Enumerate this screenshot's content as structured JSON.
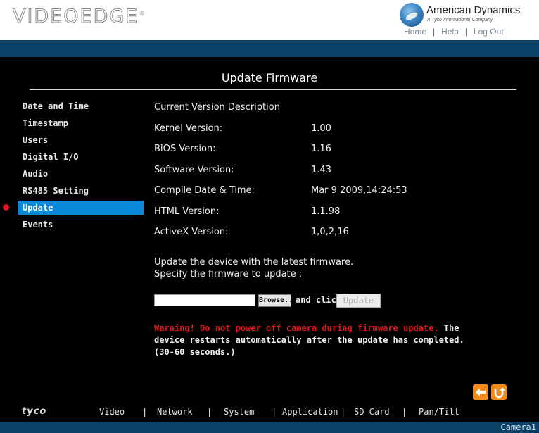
{
  "brand": {
    "logo": "VIDEOEDGE",
    "logo_reg": "®",
    "company": "American Dynamics",
    "company_sub": "A Tyco International Company"
  },
  "topnav": {
    "home": "Home",
    "help": "Help",
    "logout": "Log Out",
    "sep": "|"
  },
  "page_title": "Update Firmware",
  "sidebar": {
    "items": [
      {
        "label": "Date and Time"
      },
      {
        "label": "Timestamp"
      },
      {
        "label": "Users"
      },
      {
        "label": "Digital I/O"
      },
      {
        "label": "Audio"
      },
      {
        "label": "RS485 Setting"
      },
      {
        "label": "Update",
        "active": true
      },
      {
        "label": "Events"
      }
    ]
  },
  "versions": {
    "heading": "Current Version Description",
    "rows": [
      {
        "label": "Kernel Version:",
        "value": "1.00"
      },
      {
        "label": "BIOS Version:",
        "value": "1.16"
      },
      {
        "label": "Software Version:",
        "value": "1.43"
      },
      {
        "label": "Compile Date & Time:",
        "value": "Mar 9 2009,14:24:53"
      },
      {
        "label": "HTML Version:",
        "value": "1.1.98"
      },
      {
        "label": "ActiveX Version:",
        "value": "1,0,2,16"
      }
    ]
  },
  "update": {
    "line1": "Update the device with the latest firmware.",
    "line2": "Specify the firmware to update :",
    "file_value": "",
    "browse_label": "Browse...",
    "and_click": "and click",
    "update_label": "Update",
    "warning_red": "Warning! Do not power off camera during firmware update.",
    "warning_rest": " The device restarts automatically after the update has completed. (30-60 seconds.)"
  },
  "bottomnav": {
    "tyco": "tyco",
    "items": [
      "Video",
      "Network",
      "System",
      "Application",
      "SD Card",
      "Pan/Tilt"
    ],
    "sep": "|"
  },
  "camera_name": "Camera1",
  "colors": {
    "nav_blue": "#0c4268",
    "active_blue": "#0a88da",
    "warning_red": "#e8141c",
    "orange": "#f28a1c"
  }
}
